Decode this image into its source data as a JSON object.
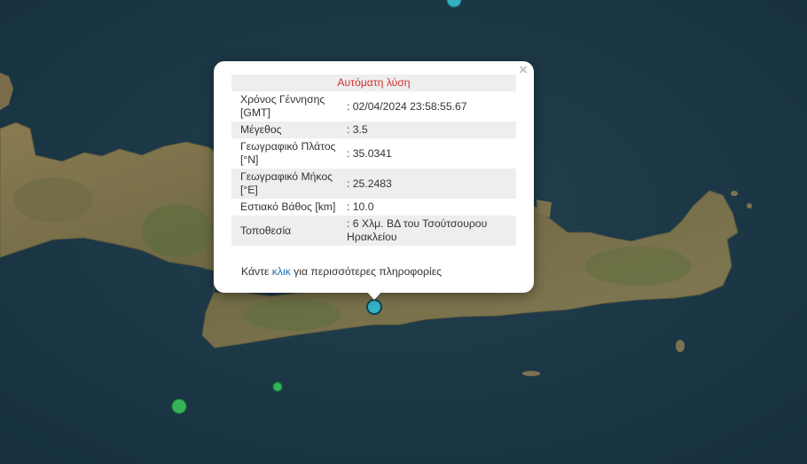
{
  "map": {
    "colors": {
      "sea": "#1d3746",
      "land": "#7d7550",
      "marker_selected": "#35b0c4",
      "marker_other": "#35b35a"
    }
  },
  "popup": {
    "title": "Αυτόματη λύση",
    "close_symbol": "×",
    "rows": [
      {
        "label": "Χρόνος Γέννησης [GMT]",
        "value": ": 02/04/2024 23:58:55.67"
      },
      {
        "label": "Μέγεθος",
        "value": ": 3.5"
      },
      {
        "label": "Γεωγραφικό Πλάτος [°N]",
        "value": ": 35.0341"
      },
      {
        "label": "Γεωγραφικό Μήκος [°E]",
        "value": ": 25.2483"
      },
      {
        "label": "Εστιακό Βάθος [km]",
        "value": ": 10.0"
      },
      {
        "label": "Τοποθεσία",
        "value": ": 6 Χλμ. ΒΔ του Τσούτσουρου Ηρακλείου"
      }
    ],
    "more_prefix": "Κάντε ",
    "more_link": "κλικ",
    "more_suffix": " για περισσότερες πληροφορίες"
  }
}
